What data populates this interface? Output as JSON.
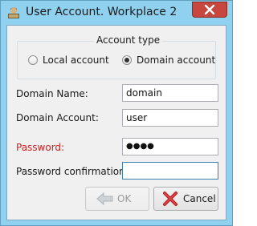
{
  "window": {
    "title": "User Account. Workplace 2"
  },
  "account_type": {
    "title": "Account type",
    "options": [
      {
        "label": "Local account",
        "selected": false
      },
      {
        "label": "Domain account",
        "selected": true
      }
    ]
  },
  "form": {
    "domain_name": {
      "label": "Domain Name:",
      "value": "domain"
    },
    "domain_account": {
      "label": "Domain Account:",
      "value": "user"
    },
    "password": {
      "label": "Password:",
      "masked_value": "●●●●",
      "required_color": "#cc2222"
    },
    "password_confirmation": {
      "label": "Password confirmation:",
      "value": ""
    }
  },
  "buttons": {
    "ok": {
      "label": "OK",
      "enabled": false,
      "icon": "arrow-left-icon"
    },
    "cancel": {
      "label": "Cancel",
      "enabled": true,
      "icon": "red-x-icon"
    }
  },
  "colors": {
    "titlebar": "#8fd1ee",
    "close_button": "#c7463d"
  }
}
